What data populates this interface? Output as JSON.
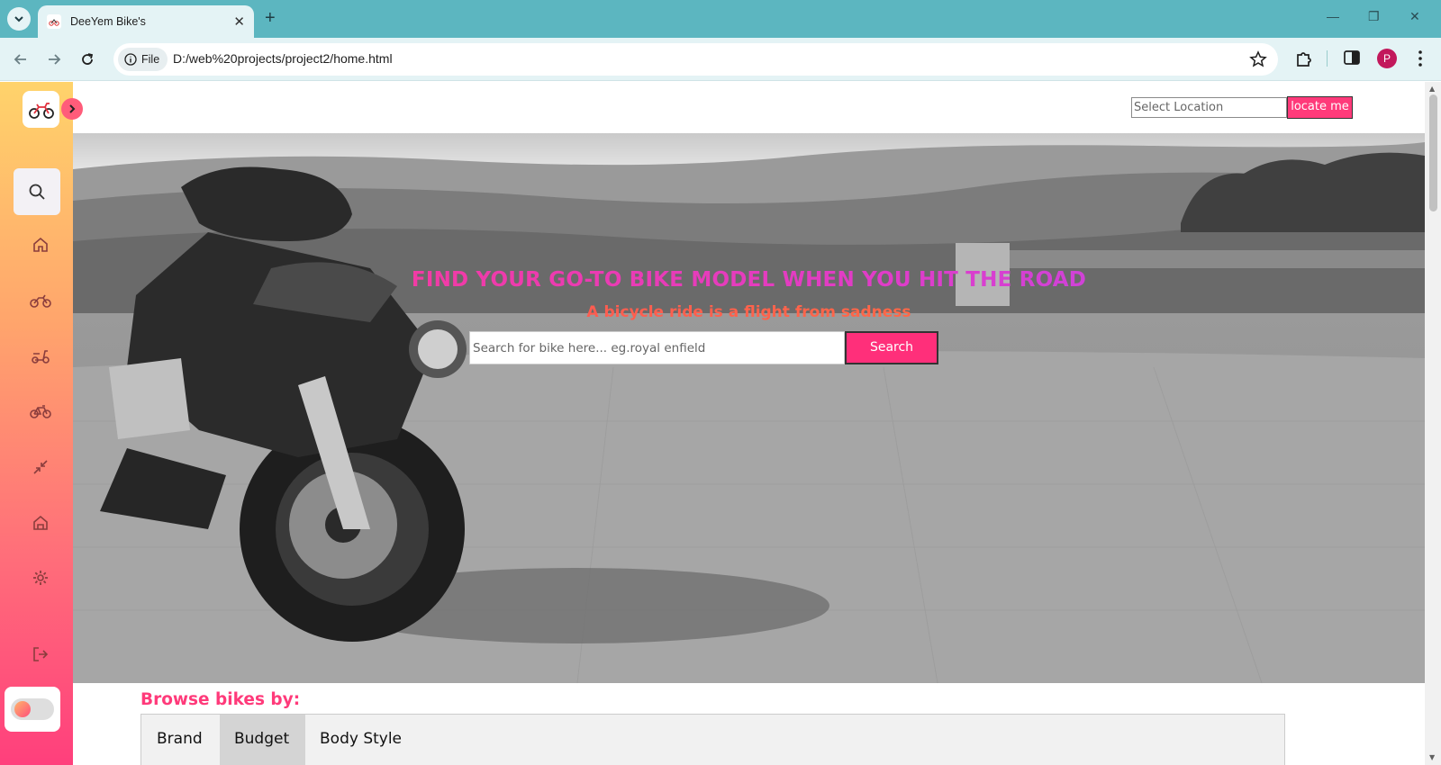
{
  "browser": {
    "tab_title": "DeeYem Bike's",
    "tab_close": "✕",
    "new_tab": "+",
    "file_chip": "File",
    "url": "D:/web%20projects/project2/home.html",
    "profile_initial": "P",
    "win_minimize": "—",
    "win_restore": "❐",
    "win_close": "✕"
  },
  "header": {
    "location_placeholder": "Select Location",
    "locate_button": "locate me"
  },
  "sidebar": {
    "items": [
      {
        "name": "search"
      },
      {
        "name": "home"
      },
      {
        "name": "motorbike"
      },
      {
        "name": "scooter"
      },
      {
        "name": "bicycle"
      },
      {
        "name": "compare"
      },
      {
        "name": "dealer"
      },
      {
        "name": "settings"
      },
      {
        "name": "logout"
      }
    ],
    "accent_colors": [
      "#ffd36b",
      "#ff3f7c"
    ]
  },
  "hero": {
    "title": "FIND YOUR GO-TO BIKE MODEL WHEN YOU HIT THE ROAD",
    "subtitle": "A bicycle ride is a flight from sadness",
    "search_placeholder": "Search for bike here... eg.royal enfield",
    "search_button": "Search"
  },
  "browse": {
    "title": "Browse bikes by:",
    "tabs": [
      {
        "label": "Brand",
        "active": false
      },
      {
        "label": "Budget",
        "active": true
      },
      {
        "label": "Body Style",
        "active": false
      }
    ]
  },
  "colors": {
    "brand_pink": "#ff3a7a",
    "chrome_teal": "#5cb6c0"
  }
}
